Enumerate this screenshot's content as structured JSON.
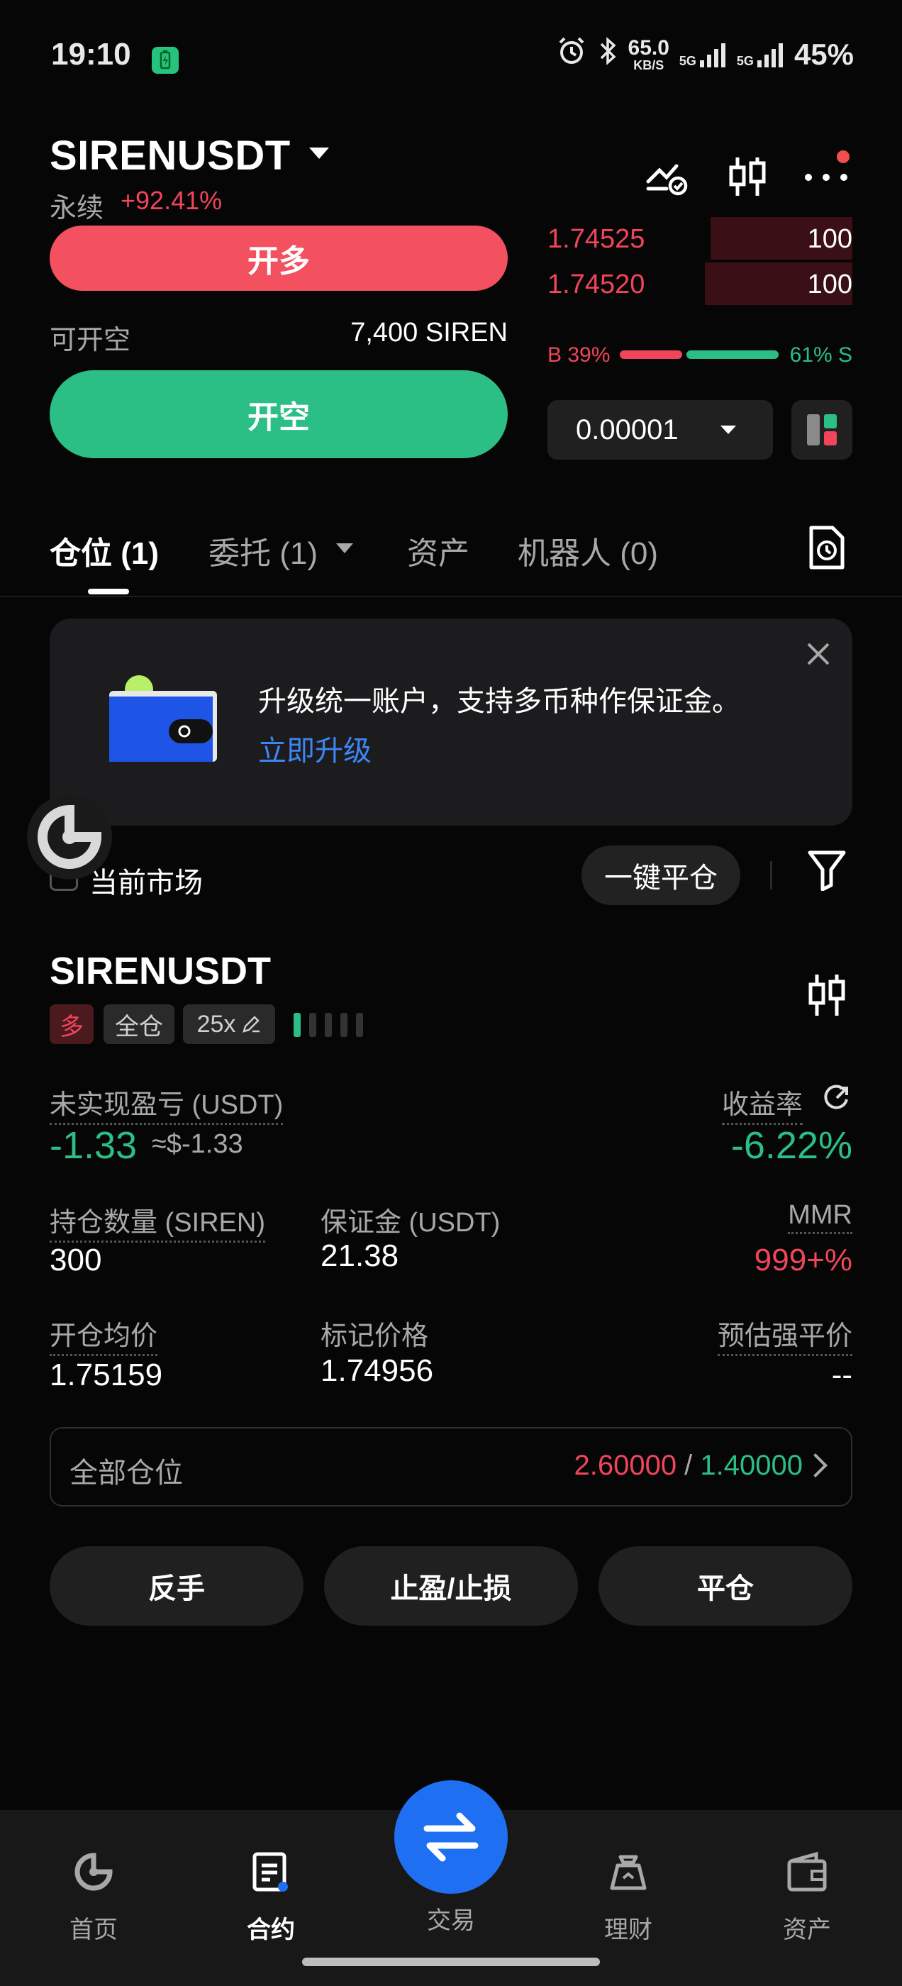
{
  "status_bar": {
    "time": "19:10",
    "net_speed": "65.0",
    "net_unit": "KB/S",
    "sig1": "5G",
    "sig2": "5G",
    "battery": "45%"
  },
  "header": {
    "symbol": "SIRENUSDT",
    "type": "永续",
    "change": "+92.41%"
  },
  "trade_panel": {
    "long_label": "开多",
    "available_label": "可开空",
    "available_value": "7,400 SIREN",
    "short_label": "开空"
  },
  "orderbook": {
    "asks": [
      {
        "price": "1.74525",
        "qty": "100"
      },
      {
        "price": "1.74520",
        "qty": "100"
      }
    ],
    "buy_ratio": "B 39%",
    "sell_ratio": "61% S",
    "precision": "0.00001"
  },
  "tabs": [
    {
      "label": "仓位 (1)"
    },
    {
      "label": "委托 (1)"
    },
    {
      "label": "资产"
    },
    {
      "label": "机器人 (0)"
    }
  ],
  "banner": {
    "text": "升级统一账户，支持多币种作保证金。",
    "link": "立即升级"
  },
  "filter": {
    "current_market": "当前市场",
    "close_all": "一键平仓"
  },
  "position": {
    "symbol": "SIRENUSDT",
    "side": "多",
    "margin_mode": "全仓",
    "leverage": "25x",
    "unrealized_label": "未实现盈亏 (USDT)",
    "unrealized_value": "-1.33",
    "unrealized_usd": "≈$-1.33",
    "roe_label": "收益率",
    "roe_value": "-6.22%",
    "qty_label": "持仓数量 (SIREN)",
    "qty_value": "300",
    "margin_label": "保证金 (USDT)",
    "margin_value": "21.38",
    "mmr_label": "MMR",
    "mmr_value": "999+%",
    "entry_label": "开仓均价",
    "entry_value": "1.75159",
    "mark_label": "标记价格",
    "mark_value": "1.74956",
    "liq_label": "预估强平价",
    "liq_value": "--",
    "all_positions_label": "全部仓位",
    "all_long": "2.60000",
    "all_sep": " / ",
    "all_short": "1.40000",
    "btn_reverse": "反手",
    "btn_tpsl": "止盈/止损",
    "btn_close": "平仓"
  },
  "bottom_nav": [
    {
      "label": "首页",
      "icon": "home-icon"
    },
    {
      "label": "合约",
      "icon": "contract-icon"
    },
    {
      "label": "交易",
      "icon": "swap-icon"
    },
    {
      "label": "理财",
      "icon": "earn-icon"
    },
    {
      "label": "资产",
      "icon": "wallet-icon"
    }
  ],
  "colors": {
    "long": "#f3515f",
    "short": "#2bbf86",
    "accent": "#1f6ff2",
    "link": "#3d86f5"
  }
}
